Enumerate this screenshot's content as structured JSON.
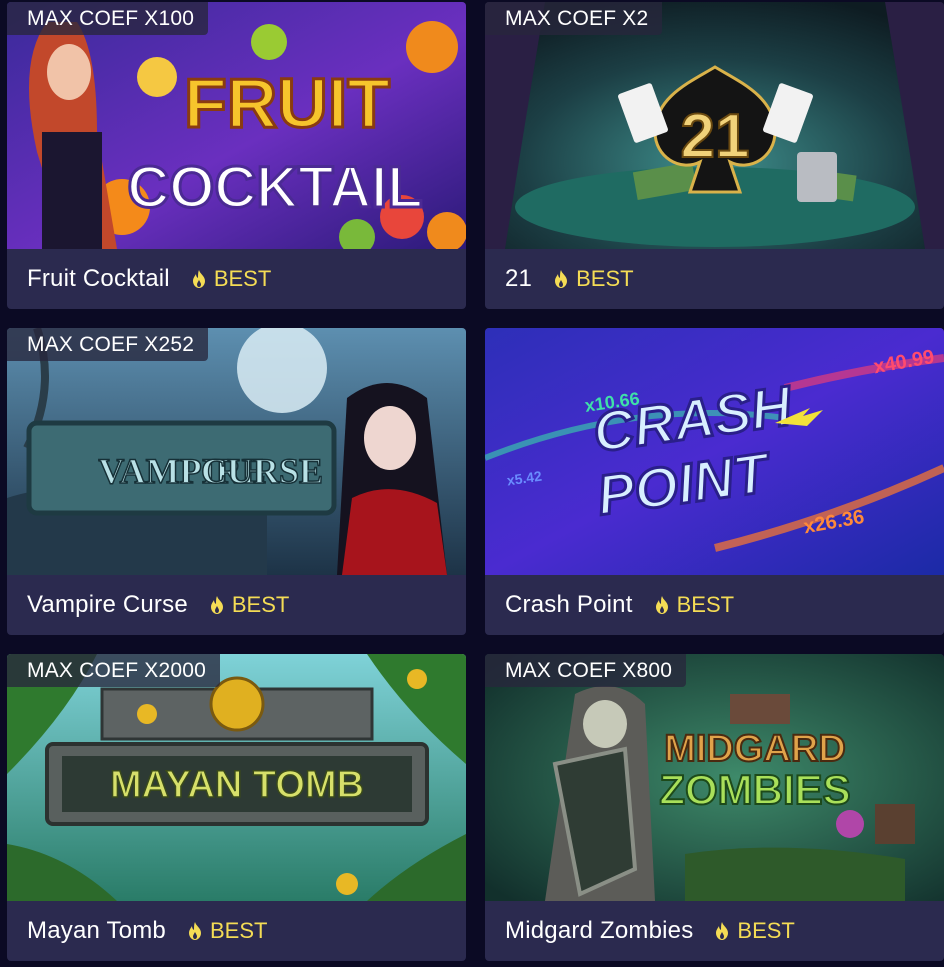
{
  "games": [
    {
      "title": "Fruit Cocktail",
      "badge": "MAX COEF X100",
      "tag": "BEST",
      "art_text": [
        "FRUIT",
        "COCKTAIL"
      ]
    },
    {
      "title": "21",
      "badge": "MAX COEF X2",
      "tag": "BEST",
      "art_text": [
        "21"
      ]
    },
    {
      "title": "Vampire Curse",
      "badge": "MAX COEF X252",
      "tag": "BEST",
      "art_text": [
        "VAMPIRE",
        "CURSE"
      ]
    },
    {
      "title": "Crash Point",
      "badge": "",
      "tag": "BEST",
      "art_text": [
        "CRASH",
        "POINT",
        "x10.66",
        "x40.99",
        "x5.42",
        "x26.36"
      ]
    },
    {
      "title": "Mayan Tomb",
      "badge": "MAX COEF X2000",
      "tag": "BEST",
      "art_text": [
        "MAYAN TOMB"
      ]
    },
    {
      "title": "Midgard Zombies",
      "badge": "MAX COEF X800",
      "tag": "BEST",
      "art_text": [
        "MIDGARD",
        "ZOMBIES"
      ]
    }
  ],
  "colors": {
    "page_bg": "#0b0a24",
    "card_bg": "#2b2a4f",
    "best_color": "#f4dc55",
    "flame_color": "#f4dc55"
  },
  "icons": {
    "tag_icon": "flame-icon"
  }
}
